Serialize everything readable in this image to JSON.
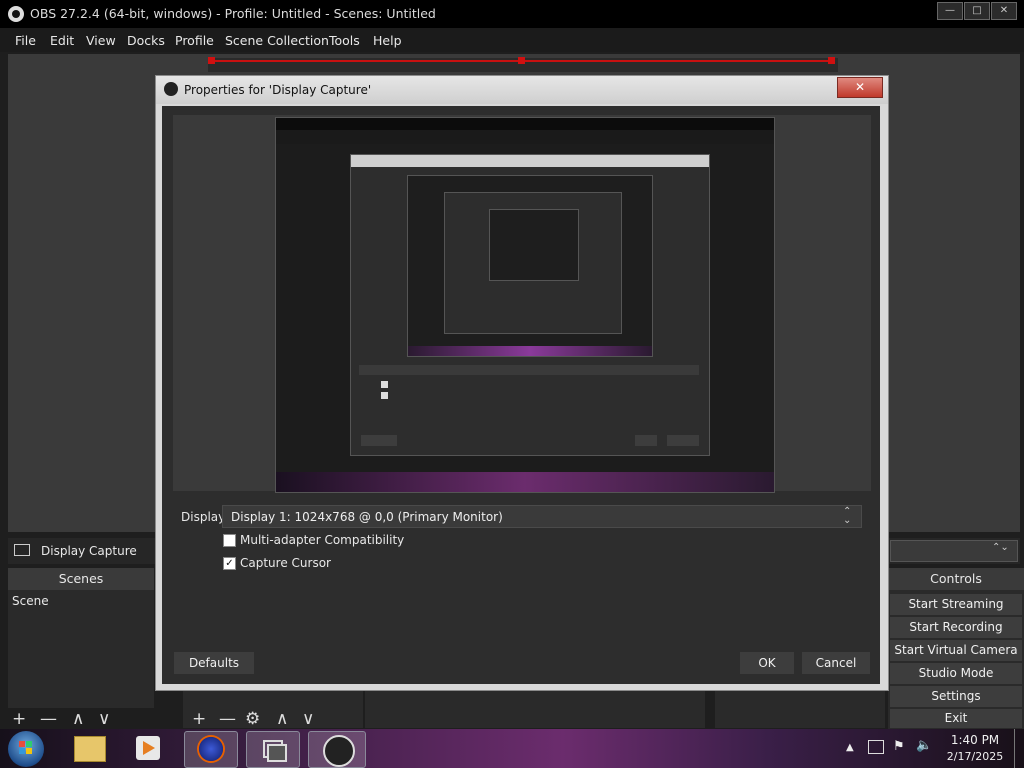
{
  "window": {
    "title": "OBS 27.2.4 (64-bit, windows) - Profile: Untitled - Scenes: Untitled",
    "controls": [
      "—",
      "□",
      "✕"
    ]
  },
  "menu": [
    "File",
    "Edit",
    "View",
    "Docks",
    "Profile",
    "Scene Collection",
    "Tools",
    "Help"
  ],
  "source_bar": {
    "source_name": "Display Capture"
  },
  "scenes_dock": {
    "header": "Scenes",
    "items": [
      "Scene"
    ],
    "toolbar": [
      "+",
      "—",
      "∧",
      "∨"
    ]
  },
  "sources_toolbar": [
    "+",
    "—",
    "⚙",
    "∧",
    "∨"
  ],
  "controls_dock": {
    "header": "Controls",
    "buttons": [
      "Start Streaming",
      "Start Recording",
      "Start Virtual Camera",
      "Studio Mode",
      "Settings",
      "Exit"
    ]
  },
  "dialog": {
    "title": "Properties for 'Display Capture'",
    "close": "✕",
    "display_label": "Display",
    "display_value": "Display 1: 1024x768 @ 0,0 (Primary Monitor)",
    "checkboxes": [
      {
        "label": "Multi-adapter Compatibility",
        "checked": false
      },
      {
        "label": "Capture Cursor",
        "checked": true
      }
    ],
    "defaults_button": "Defaults",
    "ok_button": "OK",
    "cancel_button": "Cancel"
  },
  "taskbar": {
    "time": "1:40 PM",
    "date": "2/17/2025"
  },
  "colors": {
    "accent_red": "#c81010",
    "dialog_frame": "#d9d9d9",
    "obs_dark": "#2d2d2d"
  }
}
